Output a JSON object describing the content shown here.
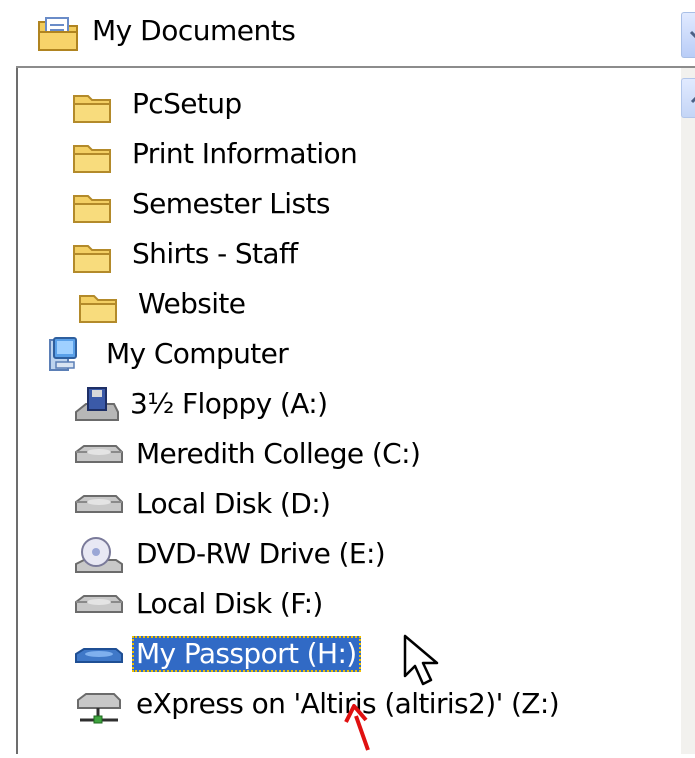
{
  "combo": {
    "label": "My Documents",
    "icon": "my-documents-icon"
  },
  "items": [
    {
      "label": "PcSetup",
      "icon": "folder-icon",
      "indent": 2
    },
    {
      "label": "Print Information",
      "icon": "folder-icon",
      "indent": 2
    },
    {
      "label": "Semester Lists",
      "icon": "folder-icon",
      "indent": 2
    },
    {
      "label": "Shirts - Staff",
      "icon": "folder-icon",
      "indent": 2
    },
    {
      "label": "Website",
      "icon": "folder-icon",
      "indent": 2
    },
    {
      "label": "My Computer",
      "icon": "computer-icon",
      "indent": 1
    },
    {
      "label": "3½ Floppy (A:)",
      "icon": "floppy-drive-icon",
      "indent": 2
    },
    {
      "label": "Meredith College (C:)",
      "icon": "hard-disk-icon",
      "indent": 2
    },
    {
      "label": "Local Disk (D:)",
      "icon": "hard-disk-icon",
      "indent": 2
    },
    {
      "label": "DVD-RW Drive (E:)",
      "icon": "dvd-drive-icon",
      "indent": 2
    },
    {
      "label": "Local Disk (F:)",
      "icon": "hard-disk-icon",
      "indent": 2
    },
    {
      "label": "My Passport (H:)",
      "icon": "external-drive-icon",
      "indent": 2,
      "selected": true
    },
    {
      "label": "eXpress on 'Altiris (altiris2)' (Z:)",
      "icon": "network-drive-icon",
      "indent": 2
    }
  ],
  "colors": {
    "selection": "#316ac5",
    "focus_outline": "#f0c000",
    "annotation_arrow": "#e01010"
  }
}
